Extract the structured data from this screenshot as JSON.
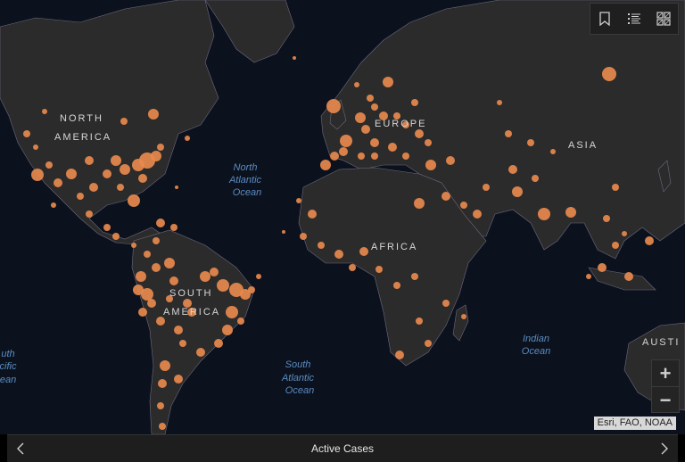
{
  "map": {
    "continents": [
      "NORTH",
      "AMERICA",
      "EUROPE",
      "ASIA",
      "AFRICA",
      "SOUTH",
      "AMERICA",
      "AUSTI"
    ],
    "oceans": [
      {
        "lines": [
          "North",
          "Atlantic",
          "Ocean"
        ]
      },
      {
        "lines": [
          "South",
          "Atlantic",
          "Ocean"
        ]
      },
      {
        "lines": [
          "Indian",
          "Ocean"
        ]
      },
      {
        "lines": [
          "uth",
          "cific",
          "ean"
        ]
      }
    ],
    "colors": {
      "land": "#2b2b2b",
      "water": "#0b121d",
      "borders": "#7a7088",
      "marker": "#e8894d",
      "label": "#d6d6d6",
      "ocean_label": "#5b8bc4"
    }
  },
  "toolbar": {
    "icons": [
      "bookmark-icon",
      "legend-list-icon",
      "basemap-gallery-icon"
    ]
  },
  "zoom": {
    "in_label": "+",
    "out_label": "−"
  },
  "attribution": "Esri, FAO, NOAA",
  "bottom_bar": {
    "title": "Active Cases",
    "prev_icon": "chevron-left-icon",
    "next_icon": "chevron-right-icon"
  }
}
